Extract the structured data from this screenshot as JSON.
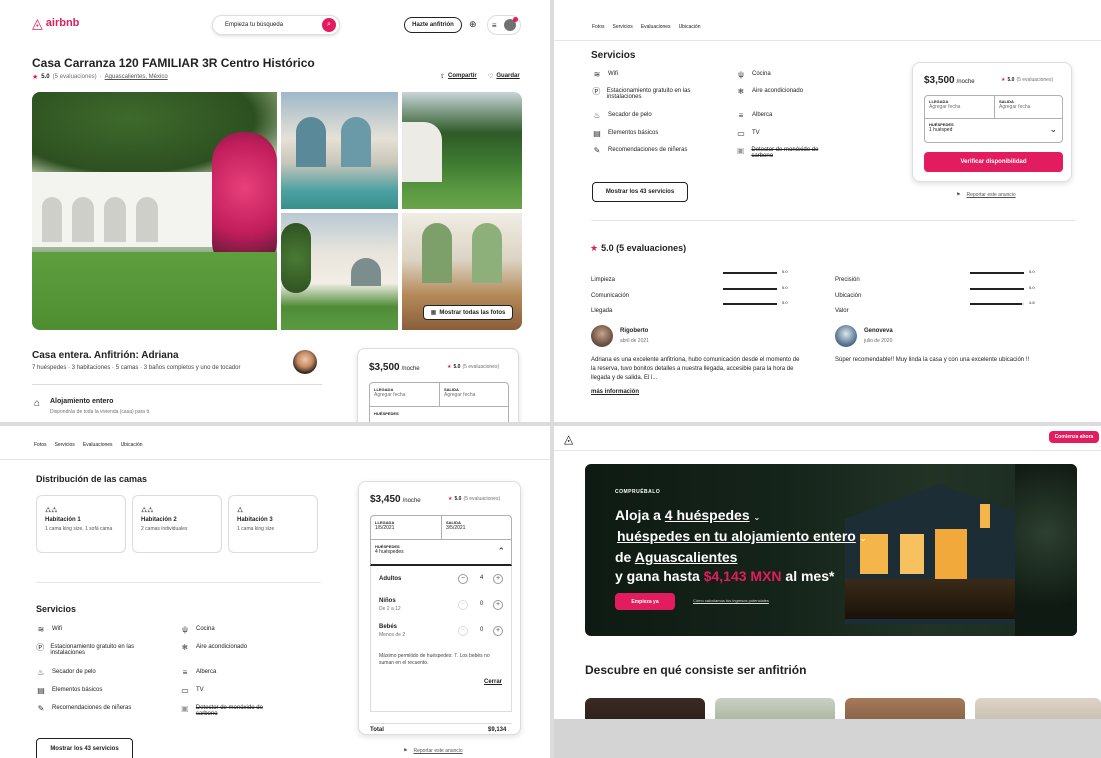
{
  "p1": {
    "logo": "airbnb",
    "search_label": "Empieza tu búsqueda",
    "host_button": "Hazte anfitrión",
    "title": "Casa Carranza 120 FAMILIAR 3R Centro Histórico",
    "rating": "5.0",
    "reviews": "(5 evaluaciones)",
    "location": "Aguascalientes, México",
    "share": "Compartir",
    "save": "Guardar",
    "show_all_photos": "Mostrar todas las fotos",
    "host_title": "Casa entera. Anfitrión: Adriana",
    "host_sub": "7 huéspedes · 3 habitaciones · 5 camas · 3 baños completos y uno de tocador",
    "feature_title": "Alojamiento entero",
    "feature_sub": "Dispondrás de toda la vivienda (casa) para ti.",
    "price": "$3,500",
    "per_night": "/noche",
    "card_rating": "5.0",
    "card_reviews": "(5 evaluaciones)",
    "checkin_label": "LLEGADA",
    "checkin_value": "Agregar fecha",
    "checkout_label": "SALIDA",
    "checkout_value": "Agregar fecha",
    "guests_label": "HUÉSPEDES"
  },
  "p2": {
    "tabs": [
      "Fotos",
      "Servicios",
      "Evaluaciones",
      "Ubicación"
    ],
    "services_title": "Servicios",
    "services_left": [
      {
        "icon": "wifi-icon",
        "glyph": "≋",
        "label": "Wifi"
      },
      {
        "icon": "parking-icon",
        "glyph": "Ⓟ",
        "label": "Estacionamiento gratuito en las instalaciones"
      },
      {
        "icon": "hairdryer-icon",
        "glyph": "♨",
        "label": "Secador de pelo"
      },
      {
        "icon": "essentials-icon",
        "glyph": "▤",
        "label": "Elementos básicos"
      },
      {
        "icon": "babysitter-icon",
        "glyph": "✎",
        "label": "Recomendaciones de niñeras"
      }
    ],
    "services_right": [
      {
        "icon": "kitchen-icon",
        "glyph": "🍴",
        "label": "Cocina",
        "strike": false
      },
      {
        "icon": "ac-icon",
        "glyph": "❄",
        "label": "Aire acondicionado",
        "strike": false
      },
      {
        "icon": "pool-icon",
        "glyph": "≡",
        "label": "Alberca",
        "strike": false
      },
      {
        "icon": "tv-icon",
        "glyph": "▭",
        "label": "TV",
        "strike": false
      },
      {
        "icon": "co-detector-icon",
        "glyph": "▣",
        "label": "Detector de monóxido de carbono",
        "strike": true
      }
    ],
    "show_services": "Mostrar los 43 servicios",
    "price": "$3,500",
    "per_night": "/noche",
    "card_rating": "5.0",
    "card_reviews": "(5 evaluaciones)",
    "checkin_label": "LLEGADA",
    "checkin_value": "Agregar fecha",
    "checkout_label": "SALIDA",
    "checkout_value": "Agregar fecha",
    "guests_label": "HUÉSPEDES",
    "guests_value": "1 huésped",
    "check_button": "Verificar disponibilidad",
    "report": "Reportar este anuncio",
    "rating_header": "5.0 (5 evaluaciones)",
    "ratings": [
      {
        "label": "Limpieza",
        "value": "5.0",
        "score": 5.0
      },
      {
        "label": "Comunicación",
        "value": "5.0",
        "score": 5.0
      },
      {
        "label": "Llegada",
        "value": "5.0",
        "score": 5.0
      },
      {
        "label": "Precisión",
        "value": "5.0",
        "score": 5.0
      },
      {
        "label": "Ubicación",
        "value": "5.0",
        "score": 5.0
      },
      {
        "label": "Valor",
        "value": "4.8",
        "score": 4.8
      }
    ],
    "review1_name": "Rigoberto",
    "review1_date": "abril de 2021",
    "review1_text": "Adriana es una excelente anfitriona, hubo comunicación desde el momento de la reserva, tuvo bonitos detalles a nuestra llegada, accesible para la hora de llegada y de salida. El l...",
    "review1_more": "más información",
    "review2_name": "Genoveva",
    "review2_date": "julio de 2020",
    "review2_text": "Súper recomendable!! Muy linda la casa y con una excelente ubicación !!"
  },
  "p3": {
    "tabs": [
      "Fotos",
      "Servicios",
      "Evaluaciones",
      "Ubicación"
    ],
    "beds_title": "Distribución de las camas",
    "rooms": [
      {
        "name": "Habitación 1",
        "desc": "1 cama king size, 1 sofá cama",
        "icons": "⛼⛼"
      },
      {
        "name": "Habitación 2",
        "desc": "2 camas individuales",
        "icons": "⛼⛼"
      },
      {
        "name": "Habitación 3",
        "desc": "1 cama king size",
        "icons": "⛼"
      }
    ],
    "services_title": "Servicios",
    "services_left": [
      {
        "icon": "wifi-icon",
        "glyph": "≋",
        "label": "Wifi"
      },
      {
        "icon": "parking-icon",
        "glyph": "Ⓟ",
        "label": "Estacionamiento gratuito en las instalaciones"
      },
      {
        "icon": "hairdryer-icon",
        "glyph": "♨",
        "label": "Secador de pelo"
      },
      {
        "icon": "essentials-icon",
        "glyph": "▤",
        "label": "Elementos básicos"
      },
      {
        "icon": "babysitter-icon",
        "glyph": "✎",
        "label": "Recomendaciones de niñeras"
      }
    ],
    "services_right": [
      {
        "icon": "kitchen-icon",
        "glyph": "🍴",
        "label": "Cocina",
        "strike": false
      },
      {
        "icon": "ac-icon",
        "glyph": "❄",
        "label": "Aire acondicionado",
        "strike": false
      },
      {
        "icon": "pool-icon",
        "glyph": "≡",
        "label": "Alberca",
        "strike": false
      },
      {
        "icon": "tv-icon",
        "glyph": "▭",
        "label": "TV",
        "strike": false
      },
      {
        "icon": "co-detector-icon",
        "glyph": "▣",
        "label": "Detector de monóxido de carbono",
        "strike": true
      }
    ],
    "show_services": "Mostrar los 43 servicios",
    "price": "$3,450",
    "per_night": "/noche",
    "card_rating": "5.0",
    "card_reviews": "(5 evaluaciones)",
    "checkin_label": "LLEGADA",
    "checkin_value": "1/5/2021",
    "checkout_label": "SALIDA",
    "checkout_value": "3/5/2021",
    "guests_label": "HUÉSPEDES",
    "guests_value": "4 huéspedes",
    "adults_label": "Adultos",
    "adults_value": "4",
    "kids_label": "Niños",
    "kids_sub": "De 2 a 12",
    "kids_value": "0",
    "babies_label": "Bebés",
    "babies_sub": "Menos de 2",
    "babies_value": "0",
    "max_note": "Máximo permitido de huéspedes: 7. Los bebés no suman en el recuento.",
    "close": "Cerrar",
    "total_label": "Total",
    "total_value": "$9,134",
    "report": "Reportar este anuncio"
  },
  "p4": {
    "cta_button": "Comienza ahora",
    "eyebrow": "COMPRUÉBALO",
    "headline_1a": "Aloja a ",
    "headline_1b": "4 huéspedes",
    "headline_2a": "huéspedes en tu alojamiento entero",
    "headline_3a": "de ",
    "headline_3b": "Aguascalientes",
    "headline_4a": "y gana hasta ",
    "headline_4b": "$4,143 MXN",
    "headline_4c": " al mes*",
    "start_button": "Empieza ya",
    "calc_link": "Cómo calculamos tus ingresos potenciales",
    "discover_title": "Descubre en qué consiste ser anfitrión"
  }
}
